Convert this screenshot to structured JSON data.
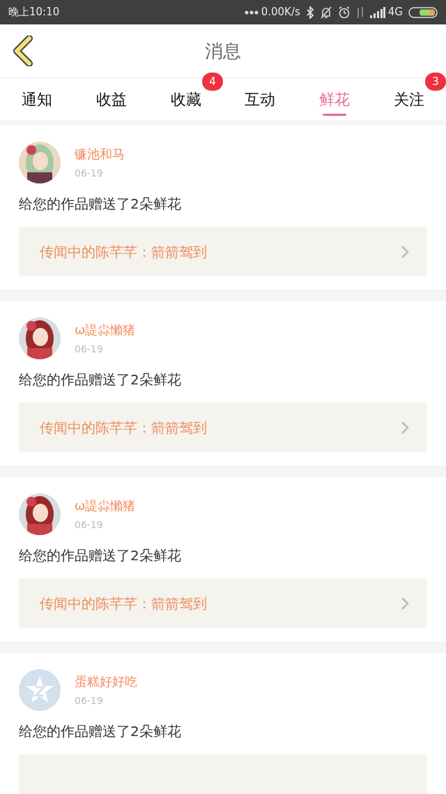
{
  "status_bar": {
    "time": "晚上10:10",
    "speed": "0.00K/s",
    "network": "4G"
  },
  "header": {
    "title": "消息"
  },
  "tabs": [
    {
      "label": "通知",
      "selected": false
    },
    {
      "label": "收益",
      "selected": false
    },
    {
      "label": "收藏",
      "selected": false,
      "badge": "4"
    },
    {
      "label": "互动",
      "selected": false
    },
    {
      "label": "鲜花",
      "selected": true
    },
    {
      "label": "关注",
      "selected": false,
      "badge": "3"
    }
  ],
  "messages": [
    {
      "kind": "picture",
      "name": "镰池和马",
      "date": "06-19",
      "text": "给您的作品赠送了2朵鲜花",
      "link": "传闻中的陈芊芊：箭箭驾到"
    },
    {
      "kind": "picture",
      "name": "ω諟尛懶猪",
      "date": "06-19",
      "text": "给您的作品赠送了2朵鲜花",
      "link": "传闻中的陈芊芊：箭箭驾到"
    },
    {
      "kind": "picture",
      "name": "ω諟尛懶猪",
      "date": "06-19",
      "text": "给您的作品赠送了2朵鲜花",
      "link": "传闻中的陈芊芊：箭箭驾到"
    },
    {
      "kind": "default",
      "name": "蛋糕好好吃",
      "date": "06-19",
      "text": "给您的作品赠送了2朵鲜花"
    }
  ]
}
